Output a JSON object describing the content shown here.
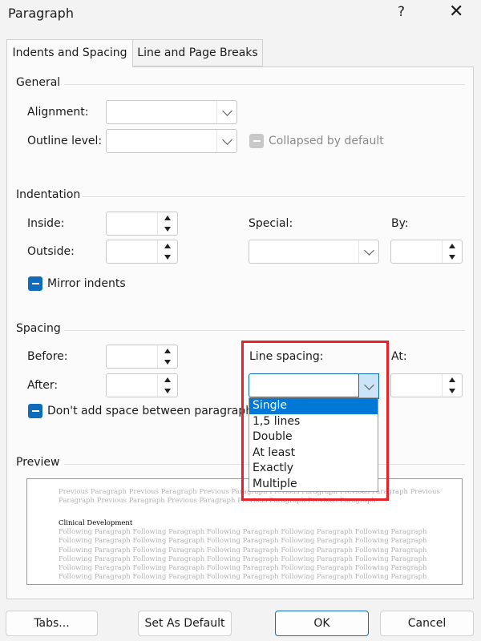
{
  "window": {
    "title": "Paragraph",
    "help": "?",
    "close": "✕"
  },
  "tabs": [
    {
      "label": "Indents and Spacing",
      "active": true
    },
    {
      "label": "Line and Page Breaks",
      "active": false
    }
  ],
  "general": {
    "group_label": "General",
    "alignment_label": "Alignment:",
    "alignment_value": "",
    "outline_label": "Outline level:",
    "outline_value": "",
    "collapsed_label": "Collapsed by default"
  },
  "indentation": {
    "group_label": "Indentation",
    "inside_label": "Inside:",
    "inside_value": "",
    "outside_label": "Outside:",
    "outside_value": "",
    "special_label": "Special:",
    "special_value": "",
    "by_label": "By:",
    "by_value": "",
    "mirror_label": "Mirror indents"
  },
  "spacing": {
    "group_label": "Spacing",
    "before_label": "Before:",
    "before_value": "",
    "after_label": "After:",
    "after_value": "",
    "line_spacing_label": "Line spacing:",
    "line_spacing_value": "",
    "at_label": "At:",
    "at_value": "",
    "dont_add_label": "Don't add space between paragraphs of"
  },
  "line_spacing_options": [
    "Single",
    "1,5 lines",
    "Double",
    "At least",
    "Exactly",
    "Multiple"
  ],
  "line_spacing_highlighted": "Single",
  "preview": {
    "group_label": "Preview",
    "previous_line1": "Previous  Paragraph  Previous  Paragraph  Previous  Paragraph  Previous  Paragraph  Previous  Paragraph  Previous",
    "previous_line2": "Paragraph Previous Paragraph Previous Paragraph Previous Paragraph Previous Paragraph",
    "sample": "Clinical Development",
    "following_line": "Following  Paragraph  Following  Paragraph  Following  Paragraph  Following  Paragraph  Following  Paragraph"
  },
  "buttons": {
    "tabs": "Tabs...",
    "set_default": "Set As Default",
    "ok": "OK",
    "cancel": "Cancel"
  },
  "colors": {
    "accent": "#0f6cbd",
    "highlight_border": "#e8202a",
    "selection": "#0078d7"
  }
}
